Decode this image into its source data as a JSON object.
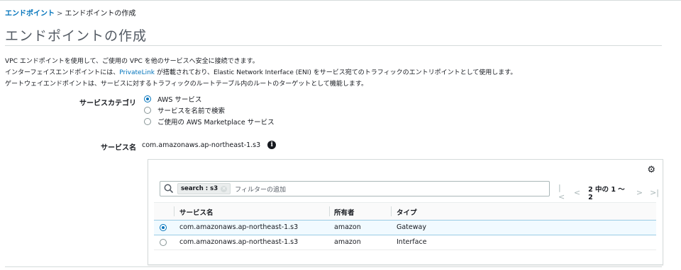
{
  "breadcrumb": {
    "link": "エンドポイント",
    "separator": ">",
    "current": "エンドポイントの作成"
  },
  "page_title": "エンドポイントの作成",
  "description": {
    "line1": "VPC エンドポイントを使用して、ご使用の VPC を他のサービスへ安全に接続できます。",
    "line2_before": "インターフェイスエンドポイントには、",
    "line2_link": "PrivateLink",
    "line2_after": " が搭載されており、Elastic Network Interface (ENI) をサービス宛てのトラフィックのエントリポイントとして使用します。",
    "line3": "ゲートウェイエンドポイントは、サービスに対するトラフィックのルートテーブル内のルートのターゲットとして機能します。"
  },
  "service_category": {
    "label": "サービスカテゴリ",
    "options": [
      {
        "label": "AWS サービス",
        "selected": true
      },
      {
        "label": "サービスを名前で検索",
        "selected": false
      },
      {
        "label": "ご使用の AWS Marketplace サービス",
        "selected": false
      }
    ]
  },
  "service_name": {
    "label": "サービス名",
    "value": "com.amazonaws.ap-northeast-1.s3",
    "info_icon": "info-icon"
  },
  "table": {
    "filter_token": "search : s3",
    "filter_placeholder": "フィルターの追加",
    "pagination": "2 中の 1 ～ 2",
    "columns": [
      "サービス名",
      "所有者",
      "タイプ"
    ],
    "rows": [
      {
        "service": "com.amazonaws.ap-northeast-1.s3",
        "owner": "amazon",
        "type": "Gateway",
        "selected": true
      },
      {
        "service": "com.amazonaws.ap-northeast-1.s3",
        "owner": "amazon",
        "type": "Interface",
        "selected": false
      }
    ]
  },
  "colors": {
    "link": "#0073bb",
    "selected_row": "#f1faff",
    "title": "#545b64"
  }
}
